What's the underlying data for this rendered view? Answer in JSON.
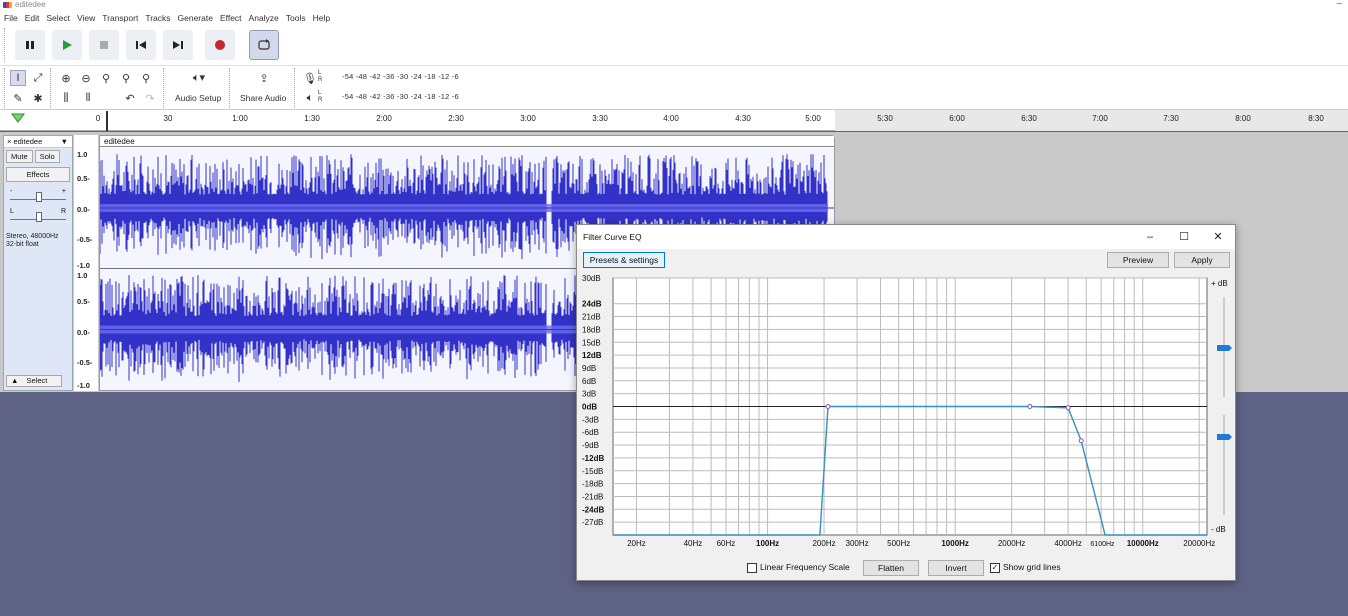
{
  "window": {
    "title": "editedee"
  },
  "menu": [
    "File",
    "Edit",
    "Select",
    "View",
    "Transport",
    "Tracks",
    "Generate",
    "Effect",
    "Analyze",
    "Tools",
    "Help"
  ],
  "toolbar": {
    "audio_setup": "Audio Setup",
    "share_audio": "Share Audio",
    "meter_scale": "-54 -48 -42 -36 -30 -24 -18 -12  -6",
    "meter_l": "L",
    "meter_r": "R"
  },
  "ruler": {
    "labels": [
      "0",
      "30",
      "1:00",
      "1:30",
      "2:00",
      "2:30",
      "3:00",
      "3:30",
      "4:00",
      "4:30",
      "5:00",
      "5:30",
      "6:00",
      "6:30",
      "7:00",
      "7:30",
      "8:00",
      "8:30"
    ]
  },
  "track": {
    "name": "editedee",
    "clip_name": "editedee",
    "mute": "Mute",
    "solo": "Solo",
    "effects": "Effects",
    "gain_minus": "-",
    "gain_plus": "+",
    "pan_l": "L",
    "pan_r": "R",
    "info_line1": "Stereo, 48000Hz",
    "info_line2": "32-bit float",
    "select": "Select",
    "scale_top": [
      "1.0",
      "0.5-",
      "0.0-",
      "-0.5-",
      "-1.0"
    ],
    "scale_bottom": [
      "1.0",
      "0.5-",
      "0.0-",
      "-0.5-",
      "-1.0"
    ]
  },
  "dialog": {
    "title": "Filter Curve EQ",
    "presets": "Presets & settings",
    "preview": "Preview",
    "apply": "Apply",
    "plus_db": "+ dB",
    "minus_db": "- dB",
    "linear_scale": "Linear Frequency Scale",
    "linear_checked": false,
    "flatten": "Flatten",
    "invert": "Invert",
    "show_grid": "Show grid lines",
    "grid_checked": true,
    "db_labels": [
      "30dB",
      "24dB",
      "21dB",
      "18dB",
      "15dB",
      "12dB",
      "9dB",
      "6dB",
      "3dB",
      "0dB",
      "-3dB",
      "-6dB",
      "-9dB",
      "-12dB",
      "-15dB",
      "-18dB",
      "-21dB",
      "-24dB",
      "-27dB"
    ],
    "db_values": [
      30,
      24,
      21,
      18,
      15,
      12,
      9,
      6,
      3,
      0,
      -3,
      -6,
      -9,
      -12,
      -15,
      -18,
      -21,
      -24,
      -27
    ],
    "bold_db": [
      "24dB",
      "12dB",
      "0dB",
      "-12dB",
      "-24dB"
    ],
    "freq_labels": [
      {
        "label": "20Hz",
        "f": 20
      },
      {
        "label": "40Hz",
        "f": 40
      },
      {
        "label": "60Hz",
        "f": 60
      },
      {
        "label": "100Hz",
        "f": 100
      },
      {
        "label": "200Hz",
        "f": 200
      },
      {
        "label": "300Hz",
        "f": 300
      },
      {
        "label": "500Hz",
        "f": 500
      },
      {
        "label": "1000Hz",
        "f": 1000
      },
      {
        "label": "2000Hz",
        "f": 2000
      },
      {
        "label": "4000Hz",
        "f": 4000
      },
      {
        "label": "6100Hz",
        "f": 6100
      },
      {
        "label": "10000Hz",
        "f": 10000
      },
      {
        "label": "20000Hz",
        "f": 20000
      }
    ],
    "bold_freq": [
      "100Hz",
      "1000Hz",
      "10000Hz"
    ]
  },
  "chart_data": {
    "type": "line",
    "title": "",
    "xlabel": "",
    "ylabel": "",
    "x_scale": "log",
    "xlim": [
      15,
      22000
    ],
    "ylim": [
      -30,
      30
    ],
    "grid": true,
    "series": [
      {
        "color": "#3b8fd6",
        "points": [
          [
            15,
            -30
          ],
          [
            190,
            -30
          ],
          [
            210,
            0
          ],
          [
            2500,
            0
          ],
          [
            4000,
            -0.3
          ],
          [
            4700,
            -8
          ],
          [
            6300,
            -30
          ],
          [
            22000,
            -30
          ]
        ]
      }
    ],
    "control_points": [
      [
        210,
        0
      ],
      [
        2500,
        0
      ],
      [
        4000,
        -0.3
      ],
      [
        4700,
        -8
      ]
    ]
  }
}
